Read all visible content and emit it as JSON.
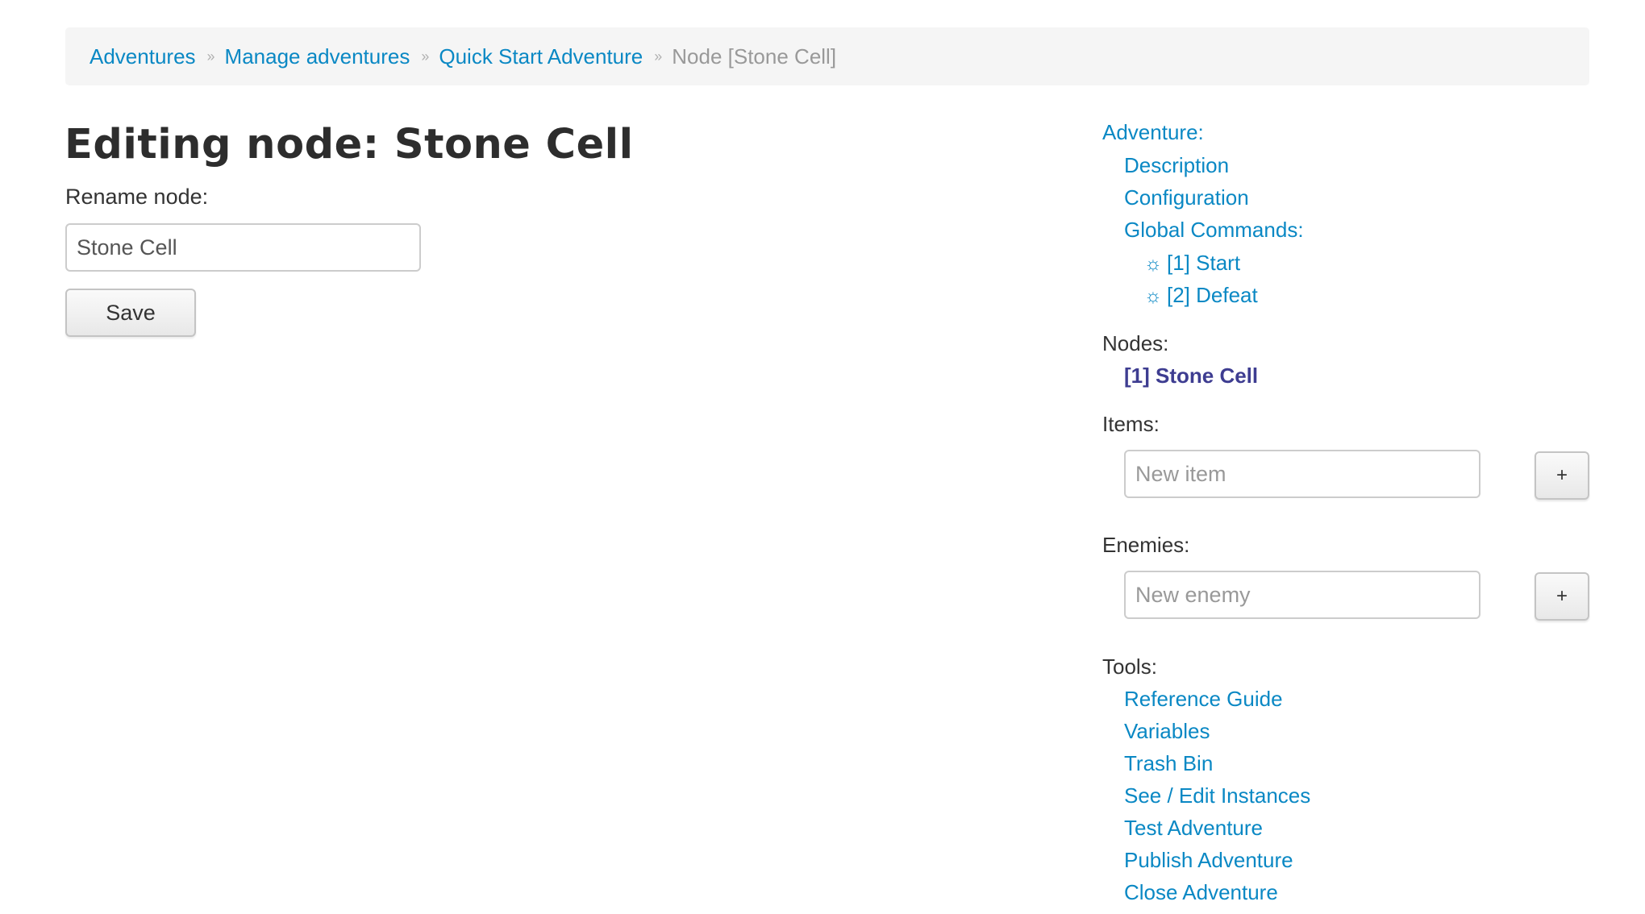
{
  "breadcrumb": {
    "items": [
      "Adventures",
      "Manage adventures",
      "Quick Start Adventure"
    ],
    "current": "Node [Stone Cell]",
    "separator": "››"
  },
  "main": {
    "title": "Editing node: Stone Cell",
    "rename_label": "Rename node:",
    "rename_value": "Stone Cell",
    "save_label": "Save"
  },
  "sidebar": {
    "adventure_label": "Adventure:",
    "description": "Description",
    "configuration": "Configuration",
    "global_commands_label": "Global Commands:",
    "global_commands": [
      {
        "icon": "gear-icon",
        "glyph": "☼",
        "label": "[1] Start"
      },
      {
        "icon": "gear-icon",
        "glyph": "☼",
        "label": "[2] Defeat"
      }
    ],
    "nodes_label": "Nodes:",
    "nodes": [
      "[1] Stone Cell"
    ],
    "items_label": "Items:",
    "items_placeholder": "New item",
    "enemies_label": "Enemies:",
    "enemies_placeholder": "New enemy",
    "add_label": "+",
    "tools_label": "Tools:",
    "tools": [
      "Reference Guide",
      "Variables",
      "Trash Bin",
      "See / Edit Instances",
      "Test Adventure",
      "Publish Adventure",
      "Close Adventure"
    ]
  },
  "colors": {
    "link": "#0a88c4",
    "current_node": "#3e3d91",
    "breadcrumb_bg": "#f5f5f5",
    "text": "#333333"
  }
}
